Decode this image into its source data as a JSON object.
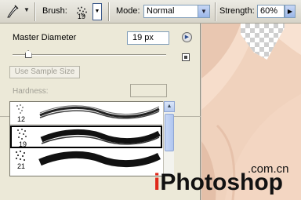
{
  "toolbar": {
    "tool": "smudge-tool",
    "brush_label": "Brush:",
    "brush_size": "19",
    "mode_label": "Mode:",
    "mode_value": "Normal",
    "strength_label": "Strength:",
    "strength_value": "60%"
  },
  "brush_panel": {
    "master_diameter_label": "Master Diameter",
    "master_diameter_value": "19 px",
    "master_diameter_slider_fraction": 0.1,
    "use_sample_size_label": "Use Sample Size",
    "hardness_label": "Hardness:",
    "presets": [
      {
        "size": "12",
        "selected": false
      },
      {
        "size": "19",
        "selected": true
      },
      {
        "size": "21",
        "selected": false
      }
    ]
  },
  "watermark": {
    "domain_suffix": ".com.cn",
    "brand_first_letter": "i",
    "brand_rest": "Photoshop"
  },
  "colors": {
    "panel_bg": "#ece9d8",
    "skin": "#f1d3bf",
    "selection": "#000000",
    "watermark_accent": "#e0281a"
  }
}
